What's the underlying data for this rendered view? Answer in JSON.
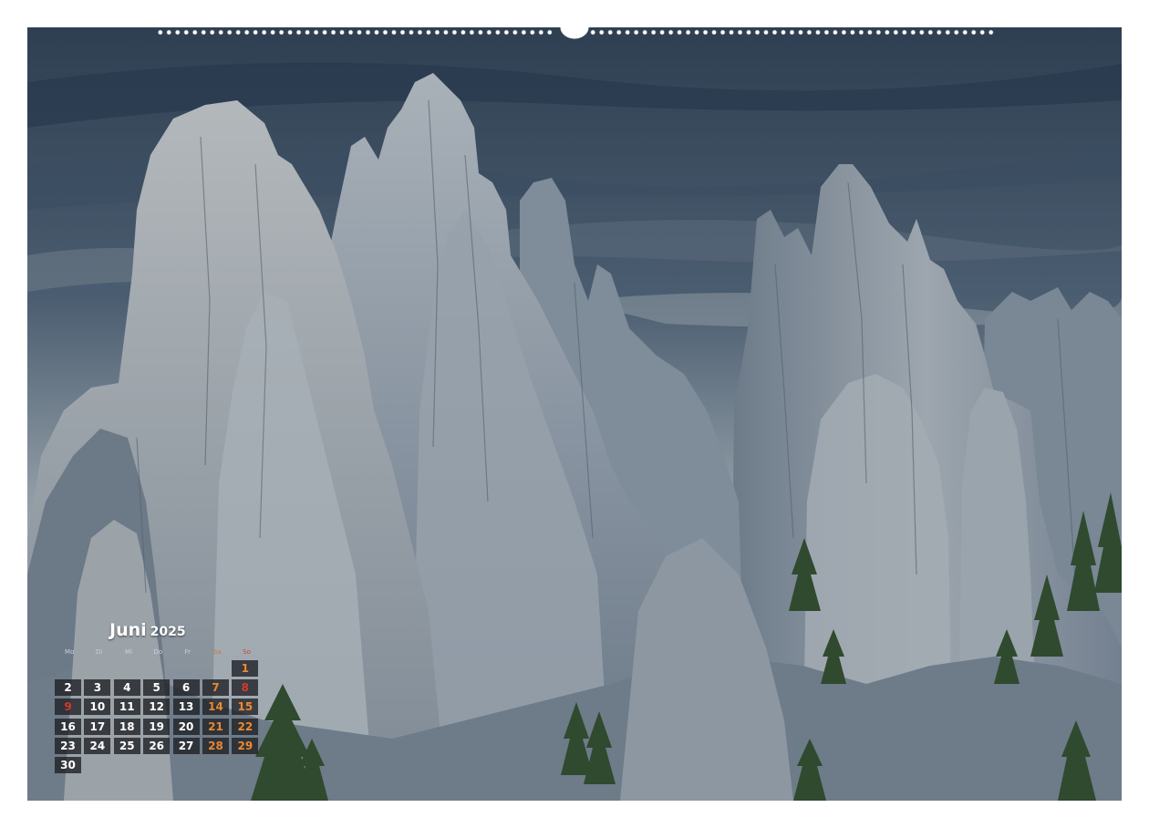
{
  "calendar": {
    "month": "Juni",
    "year": "2025",
    "weekdays": [
      "Mo",
      "Di",
      "Mi",
      "Do",
      "Fr",
      "Sa",
      "So"
    ],
    "cells": [
      {
        "day": "",
        "kind": "blank"
      },
      {
        "day": "",
        "kind": "blank"
      },
      {
        "day": "",
        "kind": "blank"
      },
      {
        "day": "",
        "kind": "blank"
      },
      {
        "day": "",
        "kind": "blank"
      },
      {
        "day": "",
        "kind": "blank"
      },
      {
        "day": "1",
        "kind": "sun"
      },
      {
        "day": "2",
        "kind": "week"
      },
      {
        "day": "3",
        "kind": "week"
      },
      {
        "day": "4",
        "kind": "week"
      },
      {
        "day": "5",
        "kind": "week"
      },
      {
        "day": "6",
        "kind": "week"
      },
      {
        "day": "7",
        "kind": "sat"
      },
      {
        "day": "8",
        "kind": "holiday"
      },
      {
        "day": "9",
        "kind": "holiday"
      },
      {
        "day": "10",
        "kind": "week"
      },
      {
        "day": "11",
        "kind": "week"
      },
      {
        "day": "12",
        "kind": "week"
      },
      {
        "day": "13",
        "kind": "week"
      },
      {
        "day": "14",
        "kind": "sat"
      },
      {
        "day": "15",
        "kind": "sun"
      },
      {
        "day": "16",
        "kind": "week"
      },
      {
        "day": "17",
        "kind": "week"
      },
      {
        "day": "18",
        "kind": "week"
      },
      {
        "day": "19",
        "kind": "week"
      },
      {
        "day": "20",
        "kind": "week"
      },
      {
        "day": "21",
        "kind": "sat"
      },
      {
        "day": "22",
        "kind": "sun"
      },
      {
        "day": "23",
        "kind": "week"
      },
      {
        "day": "24",
        "kind": "week"
      },
      {
        "day": "25",
        "kind": "week"
      },
      {
        "day": "26",
        "kind": "week"
      },
      {
        "day": "27",
        "kind": "week"
      },
      {
        "day": "28",
        "kind": "sat"
      },
      {
        "day": "29",
        "kind": "sun"
      },
      {
        "day": "30",
        "kind": "week"
      }
    ]
  },
  "photo": {
    "subject": "granite-spires-needles"
  },
  "colors": {
    "sky_dark": "#344558",
    "sky_light": "#aeb8bf",
    "rock_light": "#a7afb6",
    "rock_mid": "#7d8b99",
    "rock_shadow": "#5d6b7a",
    "tree": "#2f4a2e",
    "saturday": "#e8892e",
    "sunday": "#ef8a2b",
    "holiday": "#d33a2c",
    "cell_bg": "#1c1e22"
  }
}
